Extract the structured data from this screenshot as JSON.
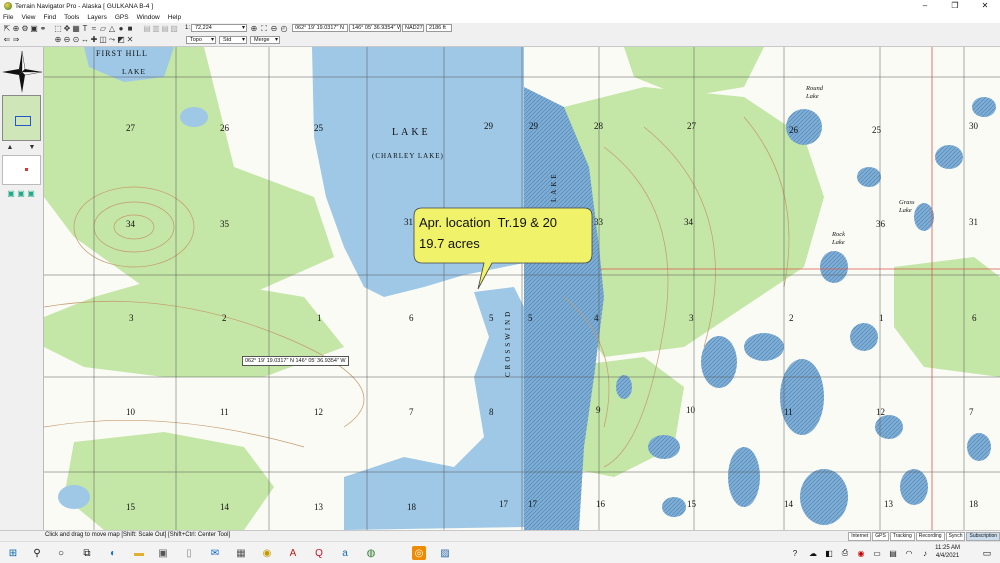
{
  "window": {
    "title": "Terrain Navigator Pro - Alaska [ GULKANA B-4 ]",
    "controls": [
      "–",
      "❐",
      "✕"
    ]
  },
  "menu": [
    "File",
    "View",
    "Find",
    "Tools",
    "Layers",
    "GPS",
    "Window",
    "Help"
  ],
  "toolbar": {
    "scale_prefix": "1:",
    "scale": "72,224",
    "coordinates": "062° 19' 19.0317\" N",
    "longitude": "146° 05' 36.9354\" W",
    "datum": "NAD27",
    "elevation": "2186 ft",
    "map_type": "Topo",
    "style": "Std",
    "mode": "Merge"
  },
  "map": {
    "callout_line1": "Apr. location  Tr.19 & 20",
    "callout_line2": "19.7 acres",
    "cursor_readout": "062° 19' 19.0317\" N 146° 05' 36.9354\" W",
    "lake_name": "LAKE",
    "lake_alias": "(CHARLEY LAKE)",
    "first_hill": "FIRST  HILL",
    "first_hill_lake": "LAKE",
    "crosswind": "CROSSWIND",
    "crosswind_lake": "LAKE",
    "round_lake": "Round Lake",
    "grass_lake": "Grass Lake",
    "rock_lake": "Rock Lake",
    "sections_row1": [
      "27",
      "26",
      "25",
      "29",
      "29",
      "28",
      "27",
      "26",
      "25",
      "30"
    ],
    "sections_row2": [
      "34",
      "35",
      "31",
      "33",
      "34",
      "36",
      "31"
    ],
    "sections_row3": [
      "3",
      "2",
      "1",
      "6",
      "5",
      "5",
      "4",
      "3",
      "2",
      "1",
      "6"
    ],
    "sections_row4": [
      "10",
      "11",
      "12",
      "7",
      "8",
      "9",
      "10",
      "11",
      "12",
      "7"
    ],
    "sections_row5": [
      "15",
      "14",
      "13",
      "18",
      "17",
      "17",
      "16",
      "15",
      "14",
      "13",
      "18"
    ],
    "colors": {
      "water": "#9ec8e6",
      "forest": "#c4e6a6",
      "swamp_blue": "#6fa0c8",
      "callout": "#f0f26a",
      "grid_red": "#d9584a"
    }
  },
  "status": {
    "message": "Click and drag to move map [Shift: Scale Out] [Shift+Ctrl: Center Tool]",
    "tabs": [
      "Internet",
      "GPS",
      "Tracking",
      "Recording",
      "Synch",
      "Subscription"
    ]
  },
  "taskbar": {
    "time": "11:25 AM",
    "date": "4/4/2021"
  }
}
